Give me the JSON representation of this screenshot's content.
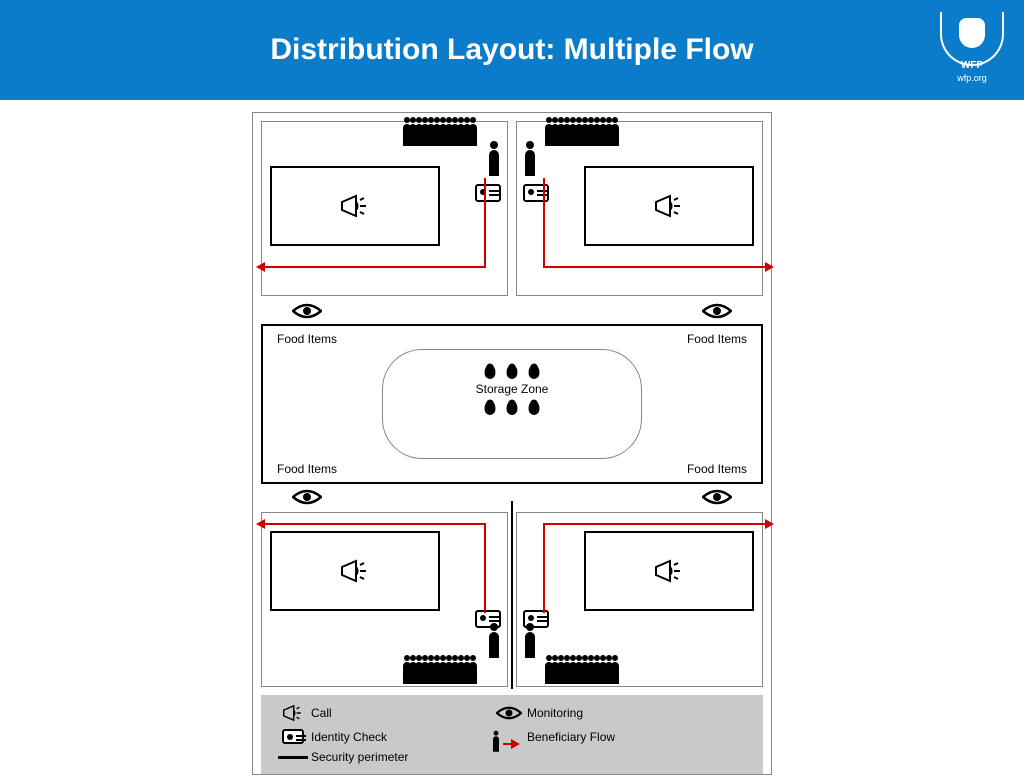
{
  "header": {
    "title": "Distribution Layout: Multiple Flow"
  },
  "logo": {
    "org": "WFP",
    "site": "wfp.org"
  },
  "center": {
    "food_tl": "Food Items",
    "food_tr": "Food Items",
    "food_bl": "Food Items",
    "food_br": "Food Items",
    "storage": "Storage Zone"
  },
  "legend": {
    "call": "Call",
    "identity": "Identity Check",
    "security": "Security perimeter",
    "monitoring": "Monitoring",
    "flow": "Beneficiary Flow"
  }
}
